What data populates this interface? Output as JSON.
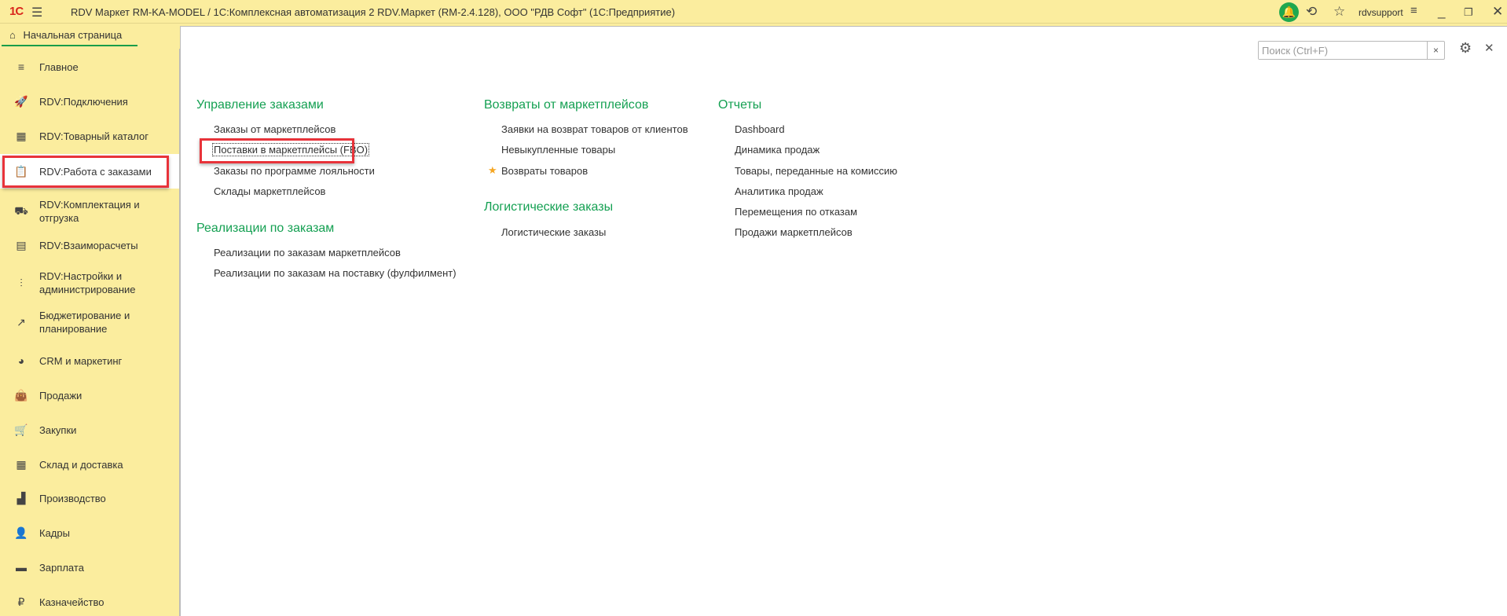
{
  "titlebar": {
    "logo": "1С",
    "title": "RDV Маркет RM-KA-MODEL / 1С:Комплексная автоматизация 2 RDV.Маркет (RM-2.4.128), ООО \"РДВ Софт\"  (1С:Предприятие)",
    "user": "rdvsupport",
    "icons": [
      "bell-icon",
      "history-icon",
      "star-icon",
      "menu-icon",
      "minimize-icon",
      "restore-icon",
      "close-icon"
    ],
    "bell_color": "#1fa84f"
  },
  "home_tab": {
    "label": "Начальная страница"
  },
  "sidebar": {
    "items": [
      {
        "label": "Главное",
        "icon": "≡"
      },
      {
        "label": "RDV:Подключения",
        "icon": "🚀"
      },
      {
        "label": "RDV:Товарный каталог",
        "icon": "▦"
      },
      {
        "label": "RDV:Работа с заказами",
        "icon": "📋"
      },
      {
        "label": "RDV:Комплектация и отгрузка",
        "icon": "⛟"
      },
      {
        "label": "RDV:Взаиморасчеты",
        "icon": "▤"
      },
      {
        "label": "RDV:Настройки и администрирование",
        "icon": "⫶"
      },
      {
        "label": "Бюджетирование и планирование",
        "icon": "↗"
      },
      {
        "label": "CRM и маркетинг",
        "icon": "◕"
      },
      {
        "label": "Продажи",
        "icon": "👜"
      },
      {
        "label": "Закупки",
        "icon": "🛒"
      },
      {
        "label": "Склад и доставка",
        "icon": "▦"
      },
      {
        "label": "Производство",
        "icon": "▟"
      },
      {
        "label": "Кадры",
        "icon": "👤"
      },
      {
        "label": "Зарплата",
        "icon": "▬"
      },
      {
        "label": "Казначейство",
        "icon": "₽"
      }
    ]
  },
  "search": {
    "placeholder": "Поиск (Ctrl+F)",
    "value": "",
    "clear": "×"
  },
  "sections": {
    "orders": {
      "title": "Управление заказами",
      "items": [
        "Заказы от маркетплейсов",
        "Поставки в маркетплейсы (FBO)",
        "Заказы по программе лояльности",
        "Склады маркетплейсов"
      ]
    },
    "sales": {
      "title": "Реализации по заказам",
      "items": [
        "Реализации по заказам маркетплейсов",
        "Реализации по заказам на поставку (фулфилмент)"
      ]
    },
    "returns": {
      "title": "Возвраты от маркетплейсов",
      "items": [
        "Заявки на возврат товаров от клиентов",
        "Невыкупленные товары",
        "Возвраты товаров"
      ]
    },
    "logistics": {
      "title": "Логистические заказы",
      "items": [
        "Логистические заказы"
      ]
    },
    "reports": {
      "title": "Отчеты",
      "items": [
        "Dashboard",
        "Динамика продаж",
        "Товары, переданные на комиссию",
        "Аналитика продаж",
        "Перемещения по отказам",
        "Продажи маркетплейсов"
      ]
    }
  }
}
